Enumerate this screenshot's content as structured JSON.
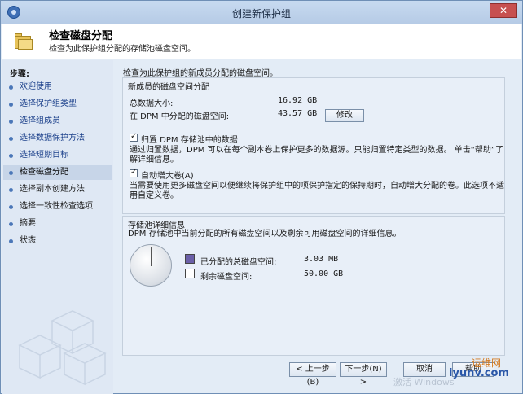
{
  "window": {
    "title": "创建新保护组",
    "close_icon": "close-icon"
  },
  "header": {
    "title": "检查磁盘分配",
    "subtitle": "检查为此保护组分配的存储池磁盘空间。"
  },
  "sidebar": {
    "title": "步骤:",
    "items": [
      {
        "label": "欢迎使用"
      },
      {
        "label": "选择保护组类型"
      },
      {
        "label": "选择组成员"
      },
      {
        "label": "选择数据保护方法"
      },
      {
        "label": "选择短期目标"
      },
      {
        "label": "检查磁盘分配"
      },
      {
        "label": "选择副本创建方法"
      },
      {
        "label": "选择一致性检查选项"
      },
      {
        "label": "摘要"
      },
      {
        "label": "状态"
      }
    ]
  },
  "main": {
    "intro": "检查为此保护组的新成员分配的磁盘空间。",
    "new_members": {
      "group_label": "新成员的磁盘空间分配",
      "total_size_label": "总数据大小:",
      "total_size_value": "16.92 GB",
      "dpm_alloc_label": "在 DPM 中分配的磁盘空间:",
      "dpm_alloc_value": "43.57 GB",
      "modify_label": "修改",
      "colocate_label": "归置 DPM 存储池中的数据",
      "colocate_desc_line1": "通过归置数据，DPM 可以在每个副本卷上保护更多的数据源。只能归置特定类型的数据。 单击“帮助”了",
      "colocate_desc_line2": "解详细信息。",
      "autogrow_label": "自动增大卷(A)",
      "autogrow_desc_line1": "当需要使用更多磁盘空间以便继续将保护组中的项保护指定的保持期时，自动增大分配的卷。此选项不适用",
      "autogrow_desc_line2": "于自定义卷。"
    },
    "storage_pool": {
      "group_label": "存储池详细信息",
      "desc": "DPM 存储池中当前分配的所有磁盘空间以及剩余可用磁盘空间的详细信息。",
      "allocated_label": "已分配的总磁盘空间:",
      "allocated_value": "3.03 MB",
      "free_label": "剩余磁盘空间:",
      "free_value": "50.00 GB",
      "allocated_color": "#6b5fa8",
      "free_color": "#ffffff"
    }
  },
  "footer": {
    "back_label": "< 上一步(B)",
    "next_label": "下一步(N) >",
    "cancel_label": "取消",
    "help_label": "帮助"
  },
  "watermark": {
    "text1": "运维网",
    "text2": "iyunv.com",
    "text3": "激活 Windows"
  }
}
